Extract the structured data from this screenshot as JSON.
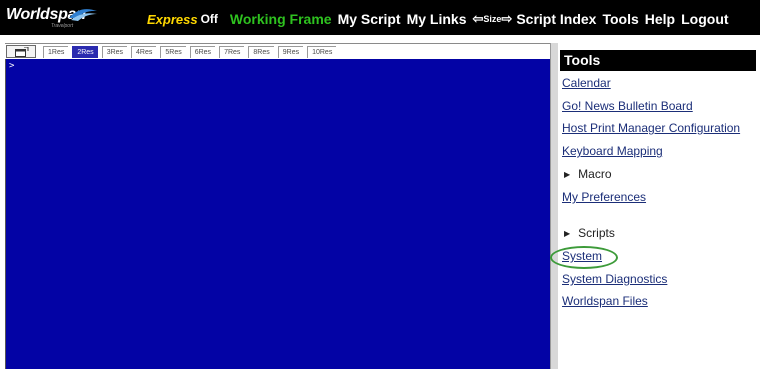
{
  "brand": {
    "name": "Worldspan",
    "tagline": "Travelport"
  },
  "menu": {
    "express": "Express",
    "express_state": "Off",
    "working_frame": "Working Frame",
    "my_script": "My Script",
    "my_links": "My Links",
    "size_left_arrow": "⇦",
    "size_label": "Size",
    "size_right_arrow": "⇨",
    "script_index": "Script Index",
    "tools": "Tools",
    "help": "Help",
    "logout": "Logout"
  },
  "tabs": {
    "items": [
      {
        "label": "1Res"
      },
      {
        "label": "2Res",
        "active": true
      },
      {
        "label": "3Res"
      },
      {
        "label": "4Res"
      },
      {
        "label": "5Res"
      },
      {
        "label": "6Res"
      },
      {
        "label": "7Res"
      },
      {
        "label": "8Res"
      },
      {
        "label": "9Res"
      },
      {
        "label": "10Res"
      }
    ]
  },
  "terminal": {
    "prompt": ">"
  },
  "tools_panel": {
    "title": "Tools",
    "items": [
      {
        "label": "Calendar",
        "kind": "link"
      },
      {
        "label": "Go! News Bulletin Board",
        "kind": "link"
      },
      {
        "label": "Host Print Manager Configuration",
        "kind": "link"
      },
      {
        "label": "Keyboard Mapping",
        "kind": "link"
      },
      {
        "label": "Macro",
        "kind": "group"
      },
      {
        "label": "My Preferences",
        "kind": "link"
      },
      {
        "label": "Scripts",
        "kind": "group"
      },
      {
        "label": "System",
        "kind": "link",
        "highlighted": true
      },
      {
        "label": "System Diagnostics",
        "kind": "link"
      },
      {
        "label": "Worldspan Files",
        "kind": "link"
      }
    ]
  },
  "colors": {
    "topbar": "#000000",
    "express": "#ffd800",
    "working_frame": "#2ec11f",
    "terminal_bg": "#0303a5",
    "link": "#1b2e78",
    "highlight": "#3d9b3a"
  }
}
